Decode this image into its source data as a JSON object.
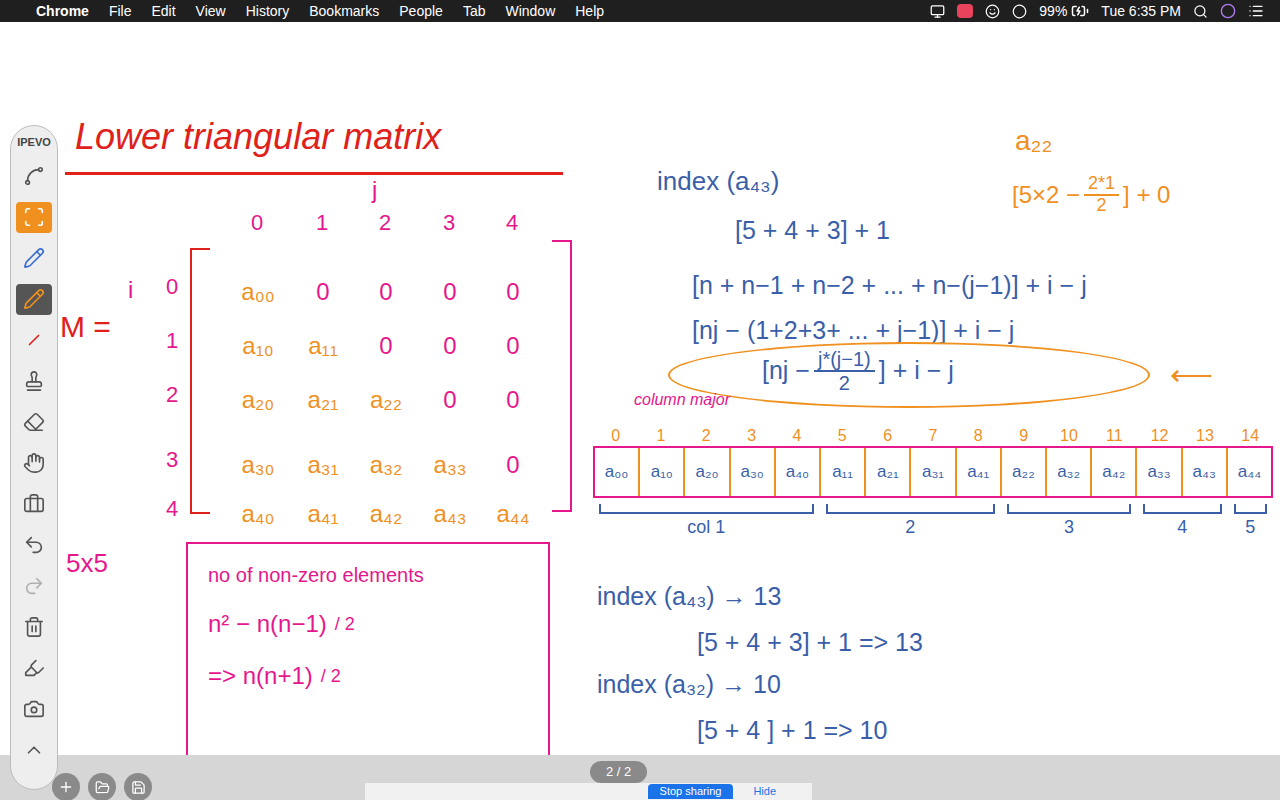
{
  "menubar": {
    "apple": "",
    "app": "Chrome",
    "menus": [
      "File",
      "Edit",
      "View",
      "History",
      "Bookmarks",
      "People",
      "Tab",
      "Window",
      "Help"
    ],
    "battery": "99%",
    "time": "Tue 6:35 PM"
  },
  "toolbar": {
    "brand": "IPEVO",
    "tools": [
      {
        "kind": "scribble",
        "selected": false
      },
      {
        "kind": "select",
        "selected": true
      },
      {
        "kind": "pen",
        "selected": false,
        "color": "#3b6fd1"
      },
      {
        "kind": "pen",
        "selected": true,
        "color": "#f0901e"
      },
      {
        "kind": "line",
        "selected": false,
        "color": "#e0201b"
      },
      {
        "kind": "stamp",
        "selected": false
      },
      {
        "kind": "eraser",
        "selected": false
      },
      {
        "kind": "hand",
        "selected": false
      },
      {
        "kind": "toolbox",
        "selected": false
      },
      {
        "kind": "undo",
        "selected": false
      },
      {
        "kind": "redo",
        "selected": false
      },
      {
        "kind": "trash",
        "selected": false
      },
      {
        "kind": "capture",
        "selected": false
      },
      {
        "kind": "camera",
        "selected": false
      },
      {
        "kind": "collapse",
        "selected": false
      }
    ]
  },
  "board": {
    "title": "Lower triangular matrix",
    "j_label": "j",
    "i_label": "i",
    "matrix_name": "M =",
    "col_labels": [
      "0",
      "1",
      "2",
      "3",
      "4"
    ],
    "row_labels": [
      "0",
      "1",
      "2",
      "3",
      "4"
    ],
    "rows": [
      [
        "a₀₀",
        "0",
        "0",
        "0",
        "0"
      ],
      [
        "a₁₀",
        "a₁₁",
        "0",
        "0",
        "0"
      ],
      [
        "a₂₀",
        "a₂₁",
        "a₂₂",
        "0",
        "0"
      ],
      [
        "a₃₀",
        "a₃₁",
        "a₃₂",
        "a₃₃",
        "0"
      ],
      [
        "a₄₀",
        "a₄₁",
        "a₄₂",
        "a₄₃",
        "a₄₄"
      ]
    ],
    "size_label": "5x5",
    "count_box": {
      "heading": "no of non-zero elements",
      "line1": "n² − n(n−1)",
      "line1_den": "2",
      "line2": "=> n(n+1)",
      "line2_den": "2"
    },
    "derivation": {
      "heading": "index (a₄₃)",
      "steps": [
        "[5 + 4 + 3] + 1",
        "[n + n−1 + n−2 + ... + n−(j−1)] + i − j",
        "[nj − (1+2+3+ ... + j−1)] + i − j"
      ],
      "formula": {
        "prefix": "[nj − ",
        "num": "j*(j−1)",
        "den": "2",
        "suffix": "] + i − j"
      },
      "arrow": "⟵"
    },
    "example": {
      "heading": "a₂₂",
      "prefix": "[5×2 − ",
      "num": "2*1",
      "den": "2",
      "suffix": "] + 0"
    },
    "column_major_label": "column major",
    "array_indices": [
      "0",
      "1",
      "2",
      "3",
      "4",
      "5",
      "6",
      "7",
      "8",
      "9",
      "10",
      "11",
      "12",
      "13",
      "14"
    ],
    "array_cells": [
      "a₀₀",
      "a₁₀",
      "a₂₀",
      "a₃₀",
      "a₄₀",
      "a₁₁",
      "a₂₁",
      "a₃₁",
      "a₄₁",
      "a₂₂",
      "a₃₂",
      "a₄₂",
      "a₃₃",
      "a₄₃",
      "a₄₄"
    ],
    "groups": [
      {
        "label": "col 1",
        "count": 5
      },
      {
        "label": "2",
        "count": 4
      },
      {
        "label": "3",
        "count": 3
      },
      {
        "label": "4",
        "count": 2
      },
      {
        "label": "5",
        "count": 1
      }
    ],
    "checks": [
      {
        "heading": "index (a₄₃) → 13",
        "work": "[5 + 4 + 3] + 1 => 13"
      },
      {
        "heading": "index (a₃₂) → 10",
        "work": "[5 + 4 ] + 1 => 10"
      }
    ]
  },
  "bottom": {
    "page": "2 / 2",
    "share_buttons": [
      "Stop sharing",
      "Hide"
    ]
  }
}
